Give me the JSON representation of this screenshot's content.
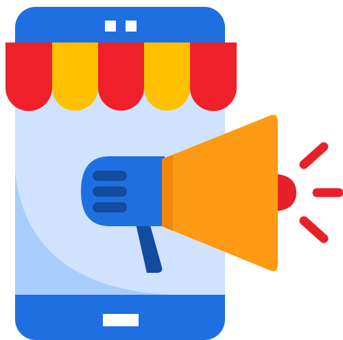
{
  "illustration": {
    "subject": "phone-shop-megaphone-icon",
    "colors": {
      "phone_body": "#1f6fe0",
      "phone_screen": "#cfe3ff",
      "screen_shadow": "#a9cdfb",
      "awning_red": "#f0202a",
      "awning_yellow": "#ffc000",
      "megaphone_cone": "#ff9a14",
      "megaphone_cone_shade": "#f0860a",
      "megaphone_handle_blue": "#1f6fe0",
      "megaphone_grip": "#134b9e",
      "sound_lines": "#e8202a",
      "white_details": "#ffffff"
    },
    "icons": [
      "phone-icon",
      "shop-awning-icon",
      "megaphone-icon",
      "sound-waves-icon"
    ]
  }
}
